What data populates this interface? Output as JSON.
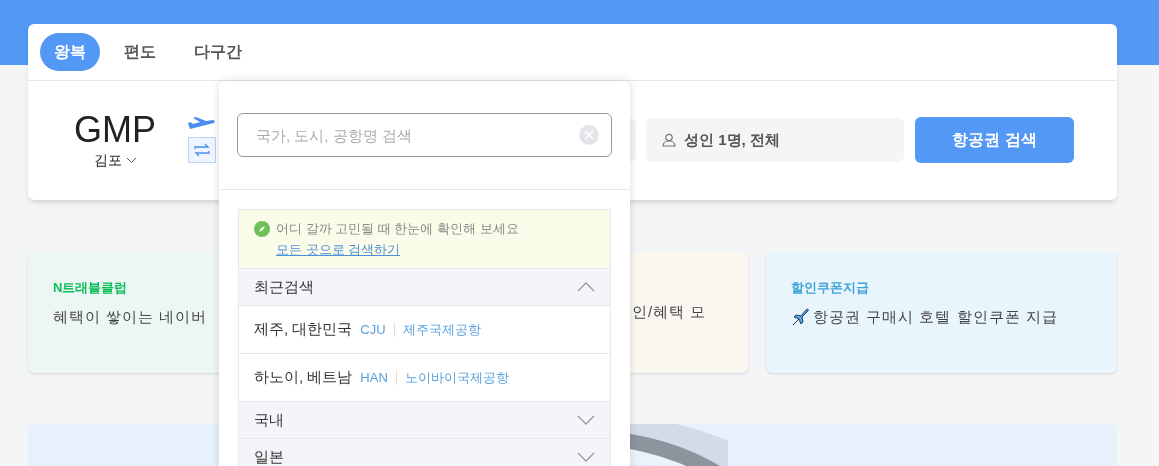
{
  "trip_tabs": [
    {
      "label": "왕복",
      "selected": true
    },
    {
      "label": "편도",
      "selected": false
    },
    {
      "label": "다구간",
      "selected": false
    }
  ],
  "origin": {
    "code": "GMP",
    "city": "김포"
  },
  "passengers": {
    "value": "성인 1명, 전체"
  },
  "search_button": "항공권 검색",
  "promo_cards": [
    {
      "title": "N트래블클럽",
      "text": "혜택이 쌓이는 네이버",
      "color": "#0bbf5a"
    },
    {
      "text": "인/혜택 모"
    },
    {
      "title": "할인쿠폰지급",
      "text": "항공권 구매시 호텔 할인쿠폰 지급",
      "color": "#3ea3d6"
    }
  ],
  "dropdown": {
    "search": {
      "placeholder": "국가, 도시, 공항명 검색"
    },
    "hint": "어디 갈까 고민될 때 한눈에 확인해 보세요",
    "hint_link": "모든 곳으로 검색하기",
    "sections": [
      {
        "label": "최근검색",
        "expanded": true,
        "items": [
          {
            "place": "제주, 대한민국",
            "code": "CJU",
            "airport": "제주국제공항"
          },
          {
            "place": "하노이, 베트남",
            "code": "HAN",
            "airport": "노이바이국제공항"
          }
        ]
      },
      {
        "label": "국내",
        "expanded": false
      },
      {
        "label": "일본",
        "expanded": false
      }
    ]
  }
}
